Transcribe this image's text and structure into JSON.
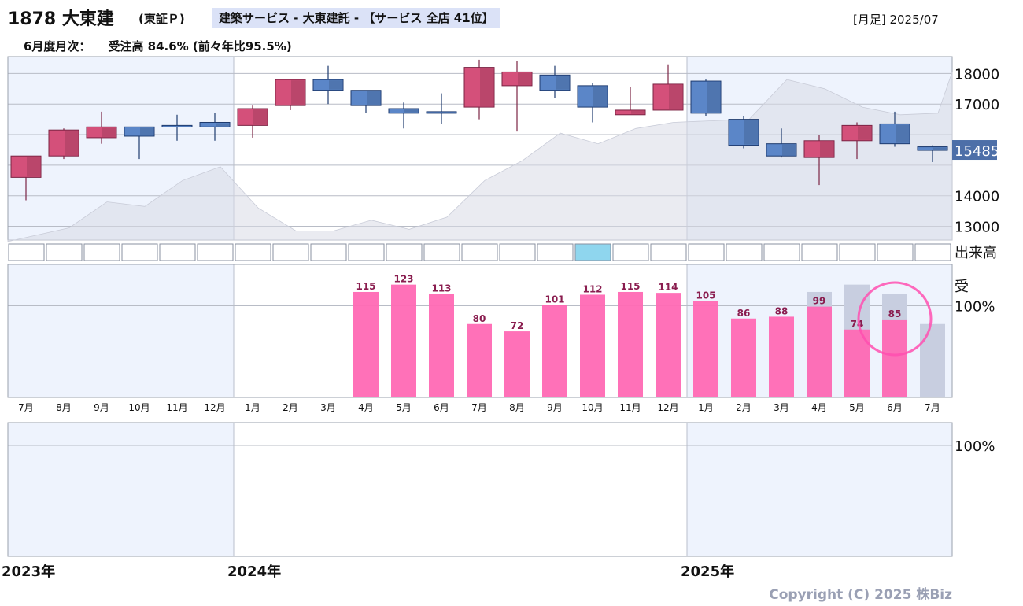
{
  "header": {
    "ticker": "1878 大東建",
    "exchange": "(東証Ｐ)",
    "sector": "建築サービス - 大東建託 - 【サービス 全店 41位】",
    "period": "[月足] 2025/07",
    "monthly_label": "6月度月次：",
    "monthly_value": "受注高 84.6% (前々年比95.5%)"
  },
  "copyright": "Copyright (C) 2025 株Biz",
  "colors": {
    "up": "#d4507a",
    "down": "#5b86c8",
    "bar": "#ff69b4",
    "bar_prev": "#c8cee0",
    "area": "#d8dbe6",
    "shade": "#eef3fd",
    "last_price_bg": "#4d6fa8"
  },
  "chart_data": [
    {
      "type": "candlestick",
      "categories": [
        "7月",
        "8月",
        "9月",
        "10月",
        "11月",
        "12月",
        "1月",
        "2月",
        "3月",
        "4月",
        "5月",
        "6月",
        "7月",
        "8月",
        "9月",
        "10月",
        "11月",
        "12月",
        "1月",
        "2月",
        "3月",
        "4月",
        "5月",
        "6月",
        "7月"
      ],
      "ohlc": [
        {
          "open": 14600,
          "high": 15300,
          "low": 13850,
          "close": 15300
        },
        {
          "open": 15300,
          "high": 16200,
          "low": 15200,
          "close": 16150
        },
        {
          "open": 15900,
          "high": 16750,
          "low": 15700,
          "close": 16250
        },
        {
          "open": 16250,
          "high": 16250,
          "low": 15200,
          "close": 15950
        },
        {
          "open": 16300,
          "high": 16650,
          "low": 15800,
          "close": 16250
        },
        {
          "open": 16400,
          "high": 16700,
          "low": 15800,
          "close": 16250
        },
        {
          "open": 16300,
          "high": 16950,
          "low": 15900,
          "close": 16850
        },
        {
          "open": 16950,
          "high": 17800,
          "low": 16800,
          "close": 17800
        },
        {
          "open": 17800,
          "high": 18250,
          "low": 17000,
          "close": 17450
        },
        {
          "open": 17450,
          "high": 17450,
          "low": 16700,
          "close": 16950
        },
        {
          "open": 16850,
          "high": 17050,
          "low": 16200,
          "close": 16700
        },
        {
          "open": 16750,
          "high": 17350,
          "low": 16350,
          "close": 16700
        },
        {
          "open": 16900,
          "high": 18450,
          "low": 16500,
          "close": 18200
        },
        {
          "open": 17600,
          "high": 18400,
          "low": 16100,
          "close": 18050
        },
        {
          "open": 17950,
          "high": 18250,
          "low": 17200,
          "close": 17450
        },
        {
          "open": 17600,
          "high": 17700,
          "low": 16400,
          "close": 16900
        },
        {
          "open": 16650,
          "high": 17550,
          "low": 16650,
          "close": 16800
        },
        {
          "open": 16800,
          "high": 18300,
          "low": 16800,
          "close": 17650
        },
        {
          "open": 17750,
          "high": 17800,
          "low": 16600,
          "close": 16700
        },
        {
          "open": 16500,
          "high": 16600,
          "low": 15550,
          "close": 15650
        },
        {
          "open": 15700,
          "high": 16200,
          "low": 15250,
          "close": 15300
        },
        {
          "open": 15250,
          "high": 16000,
          "low": 14350,
          "close": 15800
        },
        {
          "open": 15800,
          "high": 16400,
          "low": 15200,
          "close": 16300
        },
        {
          "open": 16350,
          "high": 16750,
          "low": 15600,
          "close": 15700
        },
        {
          "open": 15600,
          "high": 15650,
          "low": 15100,
          "close": 15485
        }
      ],
      "y_ticks": [
        18000,
        17000,
        14000,
        13000
      ],
      "ylim": [
        12550,
        18550
      ],
      "last_price": "15485",
      "area_values": [
        12500,
        12950,
        13800,
        13650,
        14500,
        14950,
        13600,
        12850,
        12850,
        13200,
        12900,
        13300,
        14500,
        15150,
        16050,
        15700,
        16200,
        16400,
        16450,
        16500,
        17800,
        17500,
        16900,
        16650,
        16700,
        18050
      ]
    },
    {
      "type": "volume",
      "label": "出来高",
      "cells": 25,
      "highlight_index": 15
    },
    {
      "type": "bar",
      "label_prefix": "受",
      "ref_line_label": "100%",
      "ylim": [
        0,
        145
      ],
      "ref": 100,
      "values": [
        null,
        null,
        null,
        null,
        null,
        null,
        null,
        null,
        null,
        115,
        123,
        113,
        80,
        72,
        101,
        112,
        115,
        114,
        105,
        86,
        88,
        99,
        74,
        85,
        null
      ],
      "value_labels": [
        "",
        "",
        "",
        "",
        "",
        "",
        "",
        "",
        "",
        "115",
        "123",
        "113",
        "80",
        "72",
        "101",
        "112",
        "115",
        "114",
        "105",
        "86",
        "88",
        "99",
        "74",
        "85",
        ""
      ],
      "prev_values": [
        null,
        null,
        null,
        null,
        null,
        null,
        null,
        null,
        null,
        null,
        null,
        null,
        null,
        null,
        null,
        null,
        null,
        null,
        null,
        null,
        null,
        115,
        123,
        113,
        80
      ]
    },
    {
      "type": "empty-panel",
      "ref_line_label": "100%"
    }
  ],
  "year_labels": [
    {
      "label": "2023年",
      "index": 0
    },
    {
      "label": "2024年",
      "index": 6
    },
    {
      "label": "2025年",
      "index": 18
    }
  ]
}
